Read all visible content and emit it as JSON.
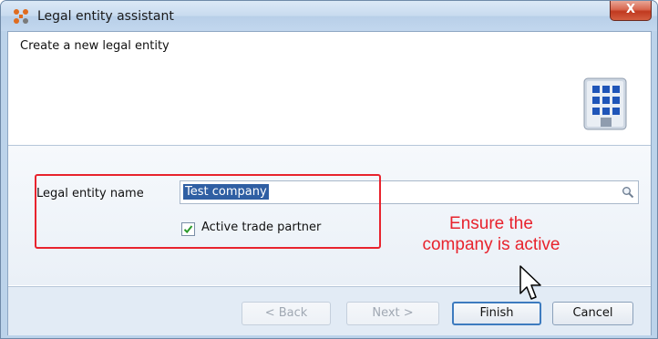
{
  "window": {
    "title": "Legal entity assistant",
    "close_label": "X"
  },
  "header": {
    "text": "Create a new legal entity",
    "icon": "building-icon"
  },
  "form": {
    "name_label": "Legal entity name",
    "name_value": "Test company",
    "search_icon": "search-icon",
    "active_label": "Active trade partner",
    "active_checked": true
  },
  "annotation": {
    "text_line1": "Ensure the",
    "text_line2": "company is active",
    "color": "#e8232d"
  },
  "buttons": {
    "back": "< Back",
    "next": "Next >",
    "finish": "Finish",
    "cancel": "Cancel"
  },
  "colors": {
    "accent": "#2f5fa3",
    "close_red": "#c0391f",
    "highlight_red": "#e8232d"
  }
}
